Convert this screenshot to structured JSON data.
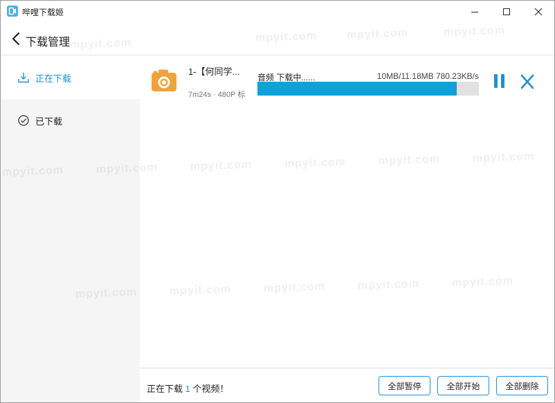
{
  "window": {
    "title": "哔哩下载姬"
  },
  "header": {
    "title": "下载管理"
  },
  "sidebar": {
    "items": [
      {
        "label": "正在下载",
        "icon": "download-icon",
        "active": true
      },
      {
        "label": "已下载",
        "icon": "check-circle-icon",
        "active": false
      }
    ]
  },
  "downloads": [
    {
      "title": "1-【何同学...",
      "meta": "7m24s · 480P 标",
      "status": "音频 下载中......",
      "size": "10MB/11.18MB 780.23KB/s",
      "progress": 0.9,
      "thumbnail": "camera-icon"
    }
  ],
  "footer": {
    "text_prefix": "正在下载 ",
    "count": "1",
    "text_suffix": " 个视频！",
    "pause_all": "全部暂停",
    "start_all": "全部开始",
    "delete_all": "全部删除"
  },
  "watermark": "mpyit.com",
  "colors": {
    "accent": "#1d91d6",
    "progress": "#0ea2d9",
    "thumbnail": "#f0a33a"
  }
}
